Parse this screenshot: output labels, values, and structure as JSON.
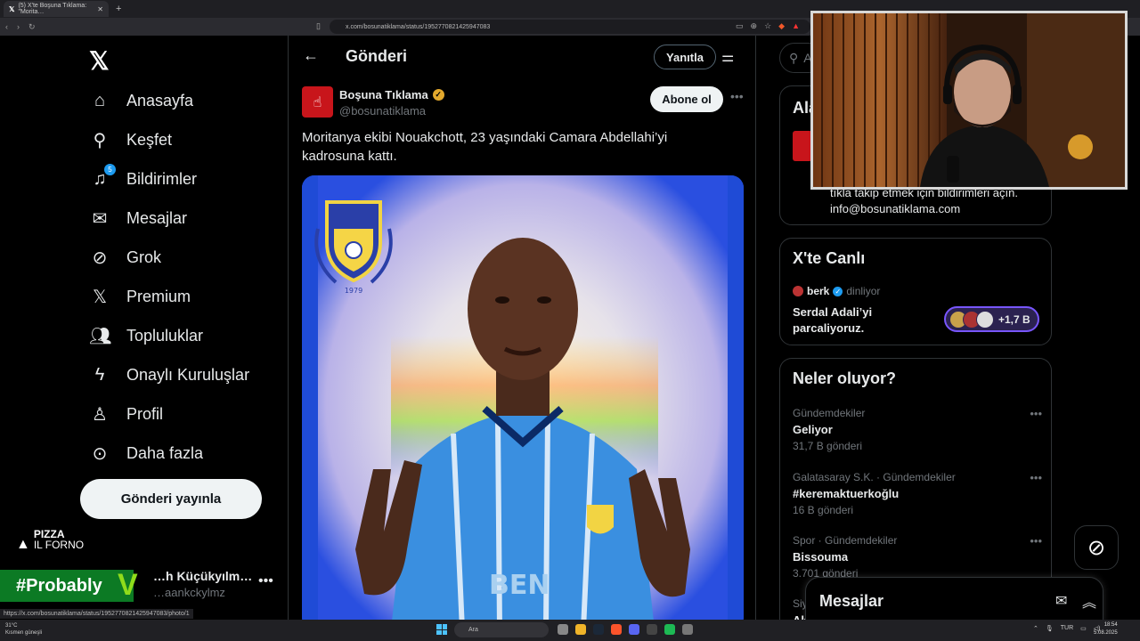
{
  "browser": {
    "tab_title": "(5) X'te Boşuna Tıklama: \"Morita…",
    "url": "x.com/bosunatiklama/status/1952770821425947083",
    "status_url": "https://x.com/bosunatiklama/status/1952770821425947083/photo/1"
  },
  "nav": {
    "items": [
      {
        "label": "Anasayfa",
        "icon": "home-icon"
      },
      {
        "label": "Keşfet",
        "icon": "search-icon"
      },
      {
        "label": "Bildirimler",
        "icon": "bell-icon",
        "badge": "5"
      },
      {
        "label": "Mesajlar",
        "icon": "mail-icon"
      },
      {
        "label": "Grok",
        "icon": "grok-icon"
      },
      {
        "label": "Premium",
        "icon": "x-icon"
      },
      {
        "label": "Topluluklar",
        "icon": "people-icon"
      },
      {
        "label": "Onaylı Kuruluşlar",
        "icon": "lightning-icon"
      },
      {
        "label": "Profil",
        "icon": "person-icon"
      },
      {
        "label": "Daha fazla",
        "icon": "more-circle-icon"
      }
    ],
    "post_button": "Gönderi yayınla",
    "account_name": "…h Küçükyılm…",
    "account_handle": "…aankckylmz",
    "overlay_brand_top": "PIZZA",
    "overlay_brand_bottom": "IL FORNO",
    "overlay_tag": "#Probably"
  },
  "main": {
    "title": "Gönderi",
    "reply_button": "Yanıtla",
    "author_name": "Boşuna Tıklama",
    "author_handle": "@bosunatiklama",
    "subscribe_button": "Abone ol",
    "post_text": "Moritanya ekibi Nouakchott, 23 yaşındaki Camara Abdellahi’yi kadrosuna kattı.",
    "crest_year": "1979",
    "jersey_text": "BEN"
  },
  "right": {
    "search_placeholder": "A",
    "about": {
      "title": "Ala",
      "line1": "tıkla takip etmek için bildirimleri açın.",
      "line2": "info@bosunatiklama.com"
    },
    "live": {
      "title": "X'te Canlı",
      "user": "berk",
      "status": "dinliyor",
      "space_title": "Serdal Adali’yi parcaliyoruz.",
      "listeners": "+1,7 B"
    },
    "trends": {
      "title": "Neler oluyor?",
      "items": [
        {
          "category": "Gündemdekiler",
          "name": "Geliyor",
          "count": "31,7 B gönderi"
        },
        {
          "category": "Galatasaray S.K. · Gündemdekiler",
          "name": "#keremaktuerkoğlu",
          "count": "16 B gönderi"
        },
        {
          "category": "Spor · Gündemdekiler",
          "name": "Bissouma",
          "count": "3.701 gönderi"
        }
      ],
      "partial_category": "Siy",
      "partial_name": "Ak"
    },
    "dm_title": "Mesajlar"
  },
  "taskbar": {
    "weather_temp": "31°C",
    "weather_desc": "Kısmen güneşli",
    "search": "Ara",
    "lang": "TUR",
    "time": "18:54",
    "date": "5.08.2025"
  },
  "colors": {
    "accent": "#1d9bf0",
    "brand_red": "#c8151b",
    "background": "#000000"
  }
}
